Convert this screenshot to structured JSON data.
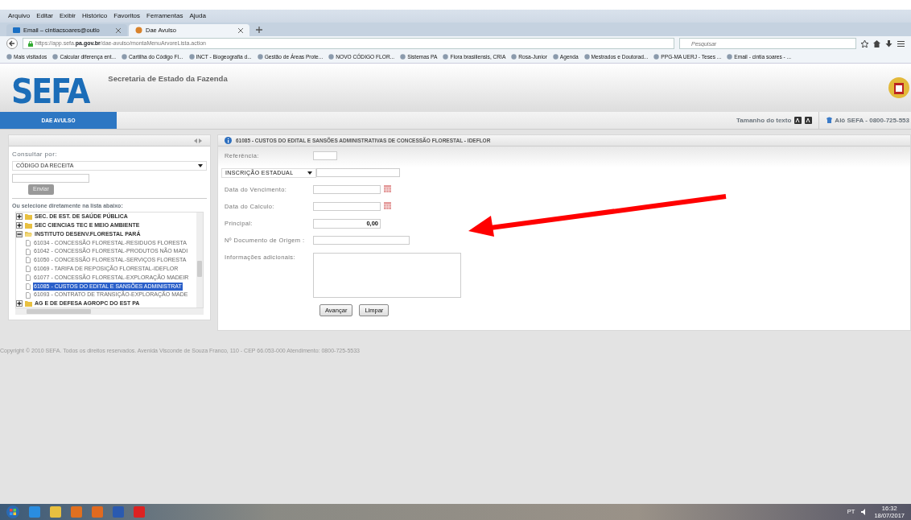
{
  "browser": {
    "menu": [
      "Arquivo",
      "Editar",
      "Exibir",
      "Histórico",
      "Favoritos",
      "Ferramentas",
      "Ajuda"
    ],
    "tabs": [
      {
        "label": "Email – cintiacsoares@outlo",
        "selected": false
      },
      {
        "label": "Dae Avulso",
        "selected": true
      }
    ],
    "url_prefix": "https://app.sefa.",
    "url_domain": "pa.gov.br",
    "url_path": "/dae-avulso/montaMenuArvoreLista.action",
    "search": {
      "placeholder": "Pesquisar"
    },
    "bookmarks": [
      "Mais visitados",
      "Calcular diferença ent...",
      "Cartilha do Código Fl...",
      "INCT - Biogeografia d...",
      "Gestão de Áreas Prote...",
      "NOVO CÓDIGO FLOR...",
      "Sistemas PA",
      "Flora brasiliensis, CRIA",
      "Rosa-Junior",
      "Agenda",
      "Mestrados e Doutorad...",
      "PPG-MA UERJ - Teses ...",
      "Email - cintia soares - ..."
    ]
  },
  "header": {
    "logo": "SEFA",
    "subtitle": "Secretaria de Estado da Fazenda"
  },
  "nav": {
    "tabs": [
      {
        "label": "DAE AVULSO",
        "selected": true
      }
    ],
    "text_size_label": "Tamanho do texto",
    "hotline": "Alô SEFA - 0800-725-553"
  },
  "sidebar": {
    "consult_label": "Consultar por:",
    "consult_select": "CÓDIGO DA RECEITA",
    "send_button": "Enviar",
    "tree_label": "Ou selecione diretamente na lista abaixo:",
    "tree": [
      {
        "label": "SEC. DE EST. DE SAÚDE PÚBLICA",
        "expanded": false
      },
      {
        "label": "SEC CIENCIAS TEC E MEIO AMBIENTE",
        "expanded": false
      },
      {
        "label": "INSTITUTO DESENV.FLORESTAL PARÁ",
        "expanded": true,
        "children": [
          {
            "label": "61034 - CONCESSÃO FLORESTAL-RESIDUOS FLORESTA",
            "selected": false
          },
          {
            "label": "61042 - CONCESSÃO FLORESTAL-PRODUTOS NÃO MADI",
            "selected": false
          },
          {
            "label": "61050 - CONCESSÃO FLORESTAL-SERVIÇOS FLORESTA",
            "selected": false
          },
          {
            "label": "61069 - TARIFA DE REPOSIÇÃO FLORESTAL-IDEFLOR",
            "selected": false
          },
          {
            "label": "61077 - CONCESSÃO FLORESTAL-EXPLORAÇÃO MADEIR",
            "selected": false
          },
          {
            "label": "61085 - CUSTOS DO EDITAL E SANSÕES ADMINISTRAT",
            "selected": true
          },
          {
            "label": "61093 - CONTRATO DE TRANSIÇÃO-EXPLORAÇÃO MADE",
            "selected": false
          }
        ]
      },
      {
        "label": "AG E DE DEFESA AGROPC DO EST PA",
        "expanded": false
      }
    ]
  },
  "form": {
    "title": "61085 - CUSTOS DO EDITAL E SANSÕES ADMINISTRATIVAS DE CONCESSÃO FLORESTAL - IDEFLOR",
    "fields": [
      {
        "kind": "short",
        "label": "Referência:"
      },
      {
        "kind": "select",
        "select_value": "INSCRIÇÃO ESTADUAL"
      },
      {
        "kind": "date",
        "label": "Data do Vencimento:"
      },
      {
        "kind": "date",
        "label": "Data do Calculo:"
      },
      {
        "kind": "money",
        "label": "Principal:",
        "value": "0,00"
      },
      {
        "kind": "text",
        "label": "Nº Documento de Origem :"
      },
      {
        "kind": "textarea",
        "label": "Informações adicionais:"
      }
    ],
    "buttons": [
      "Avançar",
      "Limpar"
    ]
  },
  "footer": "Copyright © 2010 SEFA. Todos os direitos reservados. Avenida Visconde de Souza Franco, 110 - CEP 66.053-000 Atendimento: 0800-725-5533",
  "taskbar": {
    "language": "PT",
    "time": "16:32",
    "date": "18/07/2017"
  }
}
